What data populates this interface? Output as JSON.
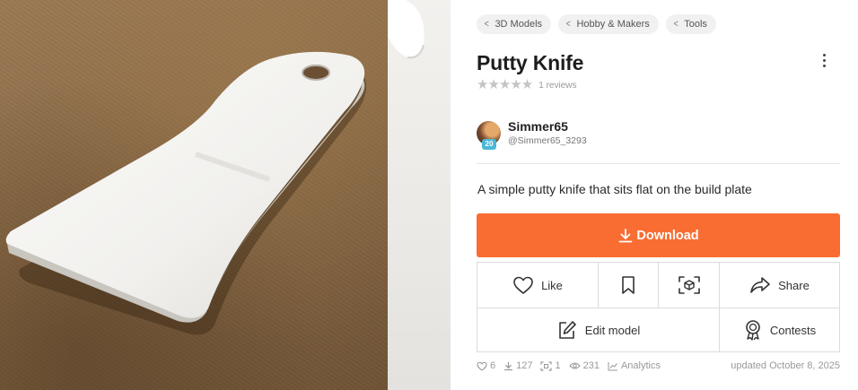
{
  "breadcrumbs": [
    {
      "label": "3D Models"
    },
    {
      "label": "Hobby & Makers"
    },
    {
      "label": "Tools"
    }
  ],
  "model": {
    "title": "Putty Knife",
    "rating_stars": 0,
    "reviews_label": "1 reviews",
    "description": "A simple putty knife that sits flat on the build plate"
  },
  "author": {
    "name": "Simmer65",
    "handle": "@Simmer65_3293",
    "level": "20"
  },
  "buttons": {
    "download": "Download",
    "like": "Like",
    "share": "Share",
    "edit_model": "Edit model",
    "contests": "Contests"
  },
  "stats": {
    "likes": "6",
    "downloads": "127",
    "makes": "1",
    "views": "231",
    "analytics": "Analytics",
    "updated": "updated October 8, 2025"
  },
  "icons": {
    "breadcrumb": "chevron-left-icon",
    "more": "more-vertical-icon",
    "download": "download-icon",
    "like": "heart-icon",
    "bookmark": "bookmark-icon",
    "ar": "ar-view-icon",
    "share": "share-icon",
    "edit": "edit-icon",
    "contests": "award-icon"
  },
  "colors": {
    "accent": "#f96d33",
    "level_badge": "#4bb7d8"
  }
}
